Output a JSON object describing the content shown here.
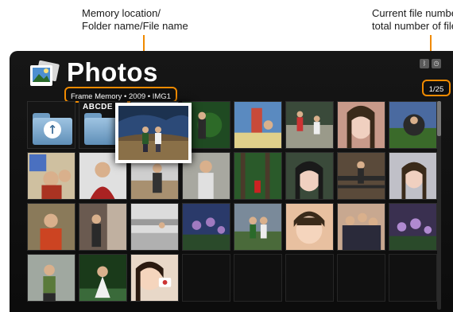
{
  "annotations": {
    "left_line1": "Memory location/",
    "left_line2": "Folder name/File name",
    "right_line1": "Current file number/",
    "right_line2": "total number of files"
  },
  "app": {
    "title": "Photos",
    "path": "Frame Memory • 2009 • IMG1",
    "counter": "1/25",
    "status_icons": [
      "bluetooth-icon",
      "clock-icon"
    ]
  },
  "grid": {
    "folder_labels": [
      "",
      "ABCDE"
    ],
    "selected_index": 2,
    "colors": {
      "highlight": "#f08a00",
      "background": "#111111",
      "text": "#ffffff"
    }
  }
}
